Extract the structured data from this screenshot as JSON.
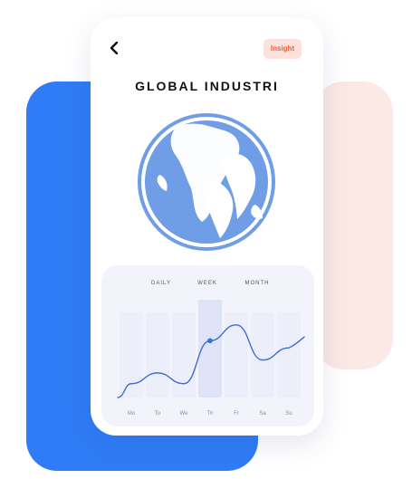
{
  "header": {
    "back_icon": "chevron-left-icon",
    "insight_label": "Insight"
  },
  "title": "GLOBAL INDUSTRI",
  "globe": {
    "icon": "globe-icon",
    "ocean_color": "#6f9de6",
    "land_color": "#ffffff"
  },
  "chart": {
    "tabs": [
      "DAILY",
      "WEEK",
      "MONTH"
    ],
    "selected_tab": "WEEK",
    "days": [
      "Mo",
      "Tu",
      "We",
      "Th",
      "Fr",
      "Sa",
      "Su"
    ],
    "highlight_day": "Th",
    "line_color": "#3b6fd6"
  },
  "chart_data": {
    "type": "line",
    "categories": [
      "Mo",
      "Tu",
      "We",
      "Th",
      "Fr",
      "Sa",
      "Su"
    ],
    "series": [
      {
        "values": [
          1.8,
          3.3,
          1.8,
          7.8,
          10.0,
          5.1,
          6.8
        ]
      }
    ],
    "ylim": [
      0,
      12
    ],
    "grid": false
  },
  "colors": {
    "accent_blue": "#2f7cf6",
    "accent_pink": "#fbe9e6",
    "badge_text": "#f15f3a",
    "card_bg": "#f3f4fb"
  }
}
